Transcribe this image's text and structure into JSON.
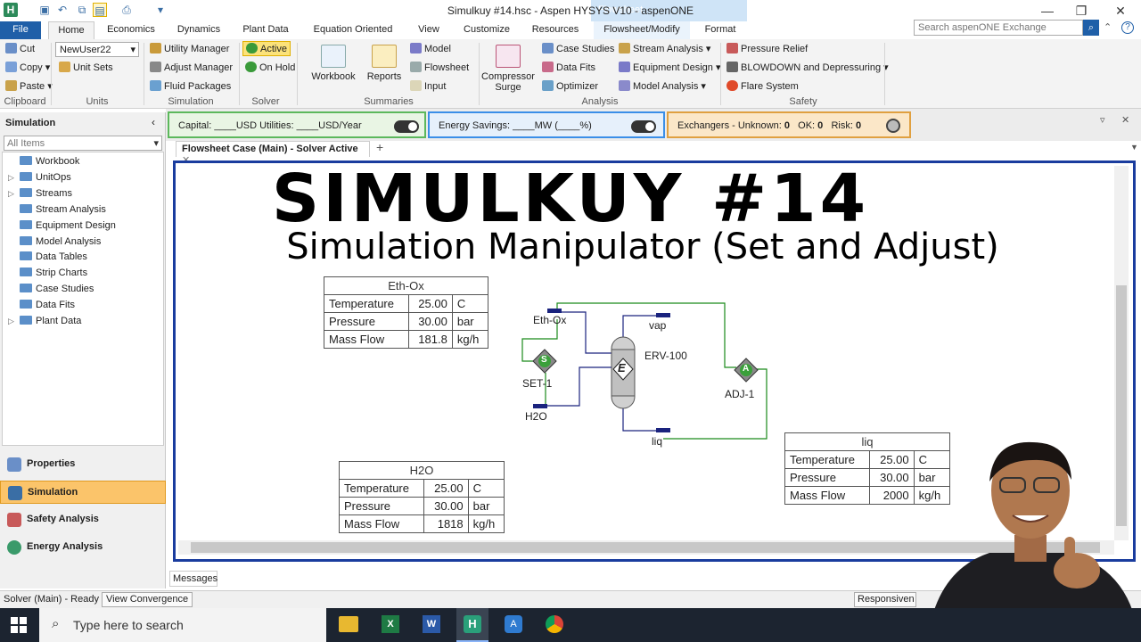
{
  "window": {
    "title": "Simulkuy #14.hsc - Aspen HYSYS V10 - aspenONE",
    "context_tab": "Flowsheet"
  },
  "search": {
    "placeholder": "Search aspenONE Exchange"
  },
  "tabs": [
    "File",
    "Home",
    "Economics",
    "Dynamics",
    "Plant Data",
    "Equation Oriented",
    "View",
    "Customize",
    "Resources",
    "Flowsheet/Modify",
    "Format"
  ],
  "ribbon": {
    "clipboard": {
      "cut": "Cut",
      "copy": "Copy",
      "paste": "Paste",
      "label": "Clipboard"
    },
    "units": {
      "set": "NewUser22",
      "unit_sets": "Unit Sets",
      "label": "Units"
    },
    "simulation": {
      "utility_manager": "Utility Manager",
      "adjust_manager": "Adjust Manager",
      "fluid_packages": "Fluid Packages",
      "label": "Simulation"
    },
    "solver": {
      "active": "Active",
      "on_hold": "On Hold",
      "label": "Solver"
    },
    "summaries": {
      "workbook": "Workbook",
      "reports": "Reports",
      "model": "Model",
      "flowsheet": "Flowsheet",
      "input": "Input",
      "label": "Summaries"
    },
    "analysis": {
      "compressor_surge_1": "Compressor",
      "compressor_surge_2": "Surge",
      "case_studies": "Case Studies",
      "data_fits": "Data Fits",
      "optimizer": "Optimizer",
      "stream_analysis": "Stream Analysis",
      "equipment_design": "Equipment Design",
      "model_analysis": "Model Analysis",
      "label": "Analysis"
    },
    "safety": {
      "pressure_relief": "Pressure Relief",
      "blowdown": "BLOWDOWN and Depressuring",
      "flare_system": "Flare System",
      "label": "Safety"
    }
  },
  "kpi": {
    "capital": "Capital: ____USD  Utilities: ____USD/Year",
    "energy": "Energy Savings: ____MW    (____%)",
    "exchangers": "Exchangers -  Unknown:",
    "unknown": "0",
    "ok_label": "OK:",
    "ok": "0",
    "risk_label": "Risk:",
    "risk": "0"
  },
  "sidebar": {
    "header": "Simulation",
    "filter": "All Items",
    "items": [
      "Workbook",
      "UnitOps",
      "Streams",
      "Stream Analysis",
      "Equipment Design",
      "Model Analysis",
      "Data Tables",
      "Strip Charts",
      "Case Studies",
      "Data Fits",
      "Plant Data"
    ],
    "nav": [
      "Properties",
      "Simulation",
      "Safety Analysis",
      "Energy Analysis"
    ]
  },
  "doc_tab": "Flowsheet Case (Main) - Solver Active",
  "overlay": {
    "heading": "SIMULKUY #14",
    "subheading": "Simulation Manipulator (Set and Adjust)"
  },
  "flowsheet": {
    "labels": {
      "eth_ox": "Eth-Ox",
      "vap": "vap",
      "erv": "ERV-100",
      "set": "SET-1",
      "adj": "ADJ-1",
      "h2o": "H2O",
      "liq": "liq",
      "set_glyph": "S",
      "adj_glyph": "A",
      "erv_glyph": "E"
    },
    "tables": [
      {
        "title": "Eth-Ox",
        "rows": [
          [
            "Temperature",
            "25.00",
            "C"
          ],
          [
            "Pressure",
            "30.00",
            "bar"
          ],
          [
            "Mass Flow",
            "181.8",
            "kg/h"
          ]
        ]
      },
      {
        "title": "H2O",
        "rows": [
          [
            "Temperature",
            "25.00",
            "C"
          ],
          [
            "Pressure",
            "30.00",
            "bar"
          ],
          [
            "Mass Flow",
            "1818",
            "kg/h"
          ]
        ]
      },
      {
        "title": "liq",
        "rows": [
          [
            "Temperature",
            "25.00",
            "C"
          ],
          [
            "Pressure",
            "30.00",
            "bar"
          ],
          [
            "Mass Flow",
            "2000",
            "kg/h"
          ]
        ]
      }
    ]
  },
  "messages_tab": "Messages",
  "status": {
    "solver": "Solver (Main) - Ready",
    "convergence": "View Convergence",
    "responsive": "Responsiven"
  },
  "taskbar": {
    "search": "Type here to search"
  }
}
